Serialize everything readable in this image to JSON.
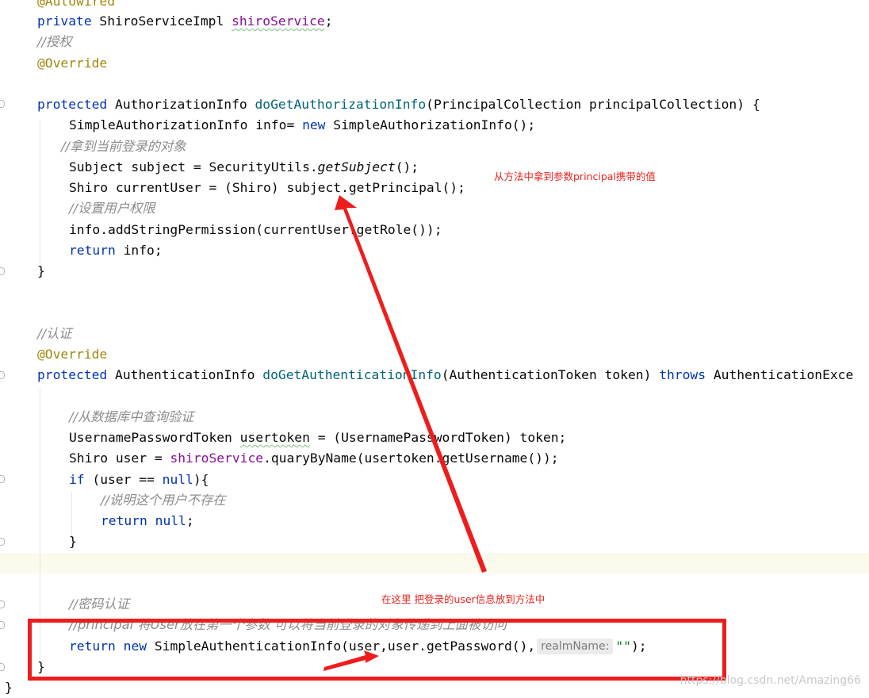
{
  "code": {
    "l_autowired": "@Autowired",
    "l_private": {
      "kw": "private",
      "type": " ShiroServiceImpl ",
      "field": "shiroService",
      "end": ";"
    },
    "l_c_auth": "//授权",
    "l_override1": "@Override",
    "l_m1": {
      "kw": "protected",
      "type": " AuthorizationInfo ",
      "name": "doGetAuthorizationInfo",
      "params": "(PrincipalCollection principalCollection) {"
    },
    "l_simple": {
      "pre": "SimpleAuthorizationInfo info= ",
      "kw": "new",
      "post": " SimpleAuthorizationInfo();"
    },
    "l_c_obj": "//拿到当前登录的对象",
    "l_subject": {
      "pre": "Subject subject = SecurityUtils.",
      "call": "getSubject",
      "post": "();"
    },
    "l_shiro": "Shiro currentUser = (Shiro) subject.getPrincipal();",
    "l_c_perm": "//设置用户权限",
    "l_addperm": "info.addStringPermission(currentUser.getRole());",
    "l_return_info": {
      "kw": "return",
      "post": " info;"
    },
    "l_close1": "}",
    "l_c_authn": "//认证",
    "l_override2": "@Override",
    "l_m2": {
      "kw": "protected",
      "type": " AuthenticationInfo ",
      "name": "doGetAuthenticationInfo",
      "params": "(AuthenticationToken token) ",
      "throws": "throws",
      "exc": " AuthenticationExce"
    },
    "l_c_db": "//从数据库中查询验证",
    "l_token": {
      "pre": "UsernamePasswordToken ",
      "var": "usertoken",
      "post": " = (UsernamePasswordToken) token;"
    },
    "l_user": {
      "pre": "Shiro user = ",
      "field": "shiroService",
      "post": ".quaryByName(usertoken.getUsername());"
    },
    "l_if": {
      "kw": "if",
      "mid": " (user == ",
      "kw2": "null",
      "post": "){"
    },
    "l_c_noexist": "//说明这个用户不存在",
    "l_return_null": {
      "kw": "return",
      "sp": " ",
      "kw2": "null",
      "post": ";"
    },
    "l_close_if": "}",
    "l_c_pwd": "//密码认证",
    "l_c_principal": "//principal 将User放在第一个参数 可以将当前登录的对象传递到上面被访问",
    "l_return_final": {
      "kw": "return",
      "sp": " ",
      "kw2": "new",
      "mid": " SimpleAuthenticationInfo(user,user.getPassword(),",
      "hint": "realmName:",
      "str": "\"\"",
      "end": ");"
    },
    "l_close2": "}",
    "l_close_class": "}"
  },
  "annotations": {
    "note_top": "从方法中拿到参数principal携带的值",
    "note_bottom": "在这里 把登录的user信息放到方法中",
    "accent": "#ee1d1d"
  },
  "watermark": "https://blog.csdn.net/Amazing66"
}
